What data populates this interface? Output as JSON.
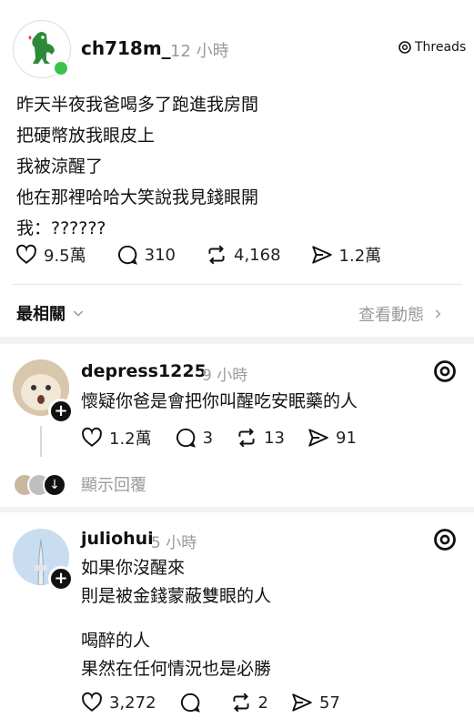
{
  "post": {
    "username": "ch718m_",
    "time": "12 小時",
    "brand": "Threads",
    "lines": [
      "昨天半夜我爸喝多了跑進我房間",
      "把硬幣放我眼皮上",
      "我被涼醒了",
      "他在那裡哈哈大笑說我見錢眼開",
      "我：??????"
    ],
    "likes": "9.5萬",
    "replies": "310",
    "reposts": "4,168",
    "shares": "1.2萬"
  },
  "sort": {
    "label": "最相關",
    "activity": "查看動態"
  },
  "comments": [
    {
      "username": "depress1225",
      "time": "9 小時",
      "lines": [
        "懷疑你爸是會把你叫醒吃安眠藥的人"
      ],
      "likes": "1.2萬",
      "replies": "3",
      "reposts": "13",
      "shares": "91",
      "show_replies": "顯示回覆"
    },
    {
      "username": "juliohui",
      "time": "5 小時",
      "lines": [
        "如果你沒醒來",
        "則是被金錢蒙蔽雙眼的人",
        "喝醉的人",
        "果然在任何情況也是必勝"
      ],
      "likes": "3,272",
      "replies": "",
      "reposts": "2",
      "shares": "57"
    }
  ]
}
